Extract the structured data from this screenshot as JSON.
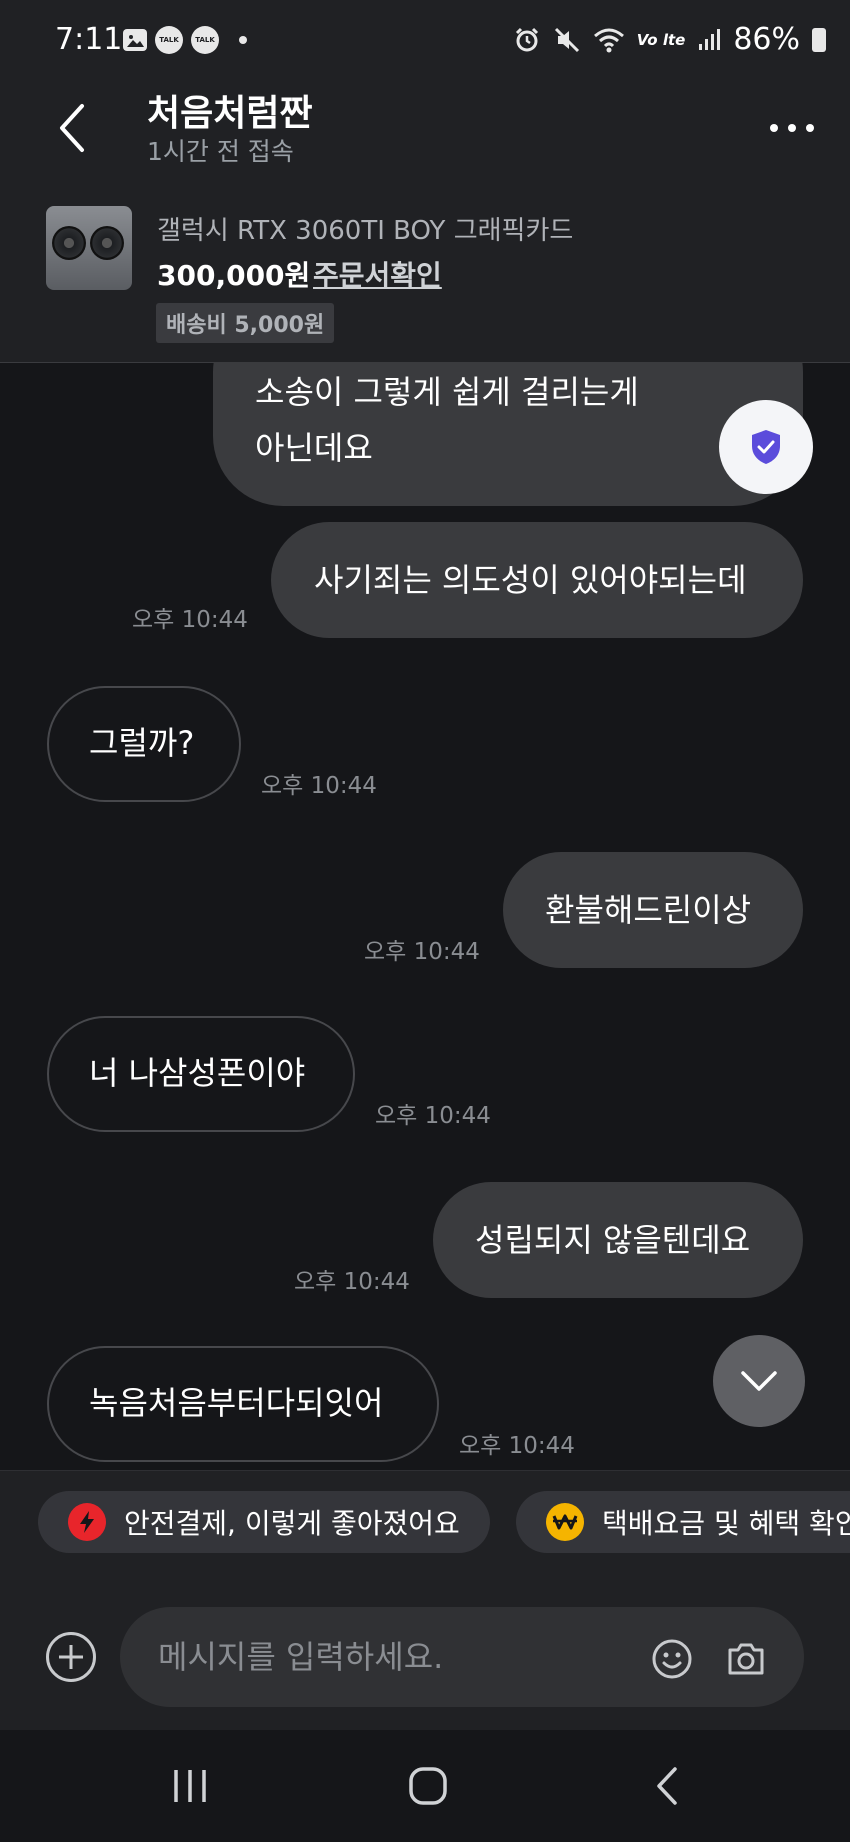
{
  "status_bar": {
    "time": "7:11",
    "notification_icons": [
      "gallery-icon",
      "kakaotalk-icon",
      "kakaotalk-icon"
    ],
    "talk_label": "TALK",
    "network_label": "Vo lte",
    "battery": "86%"
  },
  "header": {
    "title": "처음처럼짠",
    "subtitle": "1시간 전 접속"
  },
  "product": {
    "name": "갤럭시 RTX 3060TI BOY 그래픽카드",
    "price": "300,000원",
    "order_link": "주문서확인",
    "shipping": "배송비 5,000원"
  },
  "messages": [
    {
      "direction": "out",
      "text_lines": [
        "소송이 그렇게 쉽게 걸리는게",
        "아닌데요"
      ]
    },
    {
      "direction": "out",
      "text": "사기죄는 의도성이 있어야되는데",
      "time": "오후 10:44"
    },
    {
      "direction": "in",
      "text": "그럴까?",
      "time": "오후 10:44"
    },
    {
      "direction": "out",
      "text": "환불해드린이상",
      "time": "오후 10:44"
    },
    {
      "direction": "in",
      "text": "너 나삼성폰이야",
      "time": "오후 10:44"
    },
    {
      "direction": "out",
      "text": "성립되지 않을텐데요",
      "time": "오후 10:44"
    },
    {
      "direction": "in",
      "text": "녹음처음부터다되잇어",
      "time": "오후 10:44"
    }
  ],
  "quick_replies": [
    {
      "label": "안전결제, 이렇게 좋아졌어요",
      "icon": "lightning-icon",
      "color": "#e8252b"
    },
    {
      "label": "택배요금 및 혜택 확인",
      "icon": "won-coin-icon",
      "color": "#f5b400"
    }
  ],
  "composer": {
    "placeholder": "메시지를 입력하세요."
  },
  "colors": {
    "background": "#151619",
    "header": "#202124",
    "outgoing_bubble": "#3a3b3e",
    "shield_accent": "#5b4cdb"
  }
}
